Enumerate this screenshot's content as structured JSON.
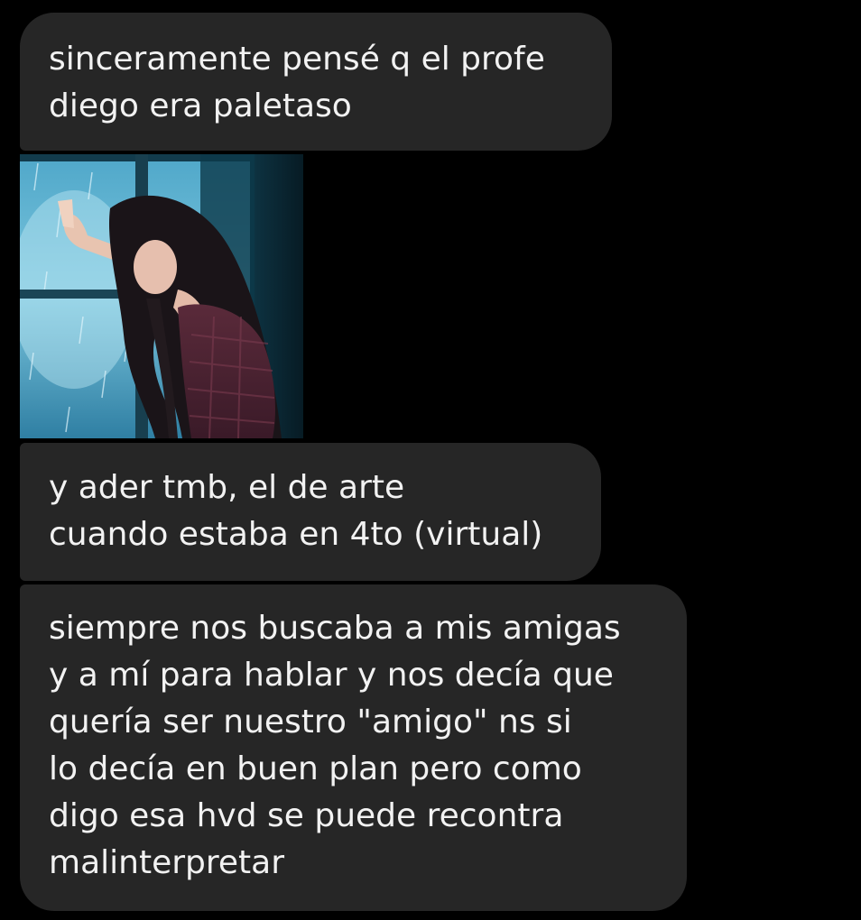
{
  "messages": [
    {
      "kind": "text",
      "lines": [
        "sinceramente pensé q el profe",
        "diego era paletaso"
      ]
    },
    {
      "kind": "image",
      "image_description": "sad-girl-by-rainy-window-image"
    },
    {
      "kind": "text",
      "lines": [
        "y ader tmb, el de arte",
        "cuando estaba en 4to (virtual)"
      ]
    },
    {
      "kind": "text",
      "lines": [
        "siempre nos buscaba a mis amigas",
        "y a mí para hablar y nos decía que",
        "quería ser nuestro \"amigo\" ns si",
        "lo decía en buen plan pero como",
        "digo esa hvd se puede recontra",
        "malinterpretar"
      ]
    }
  ],
  "colors": {
    "background": "#000000",
    "bubble": "#262626",
    "text": "#f2f2f2"
  }
}
